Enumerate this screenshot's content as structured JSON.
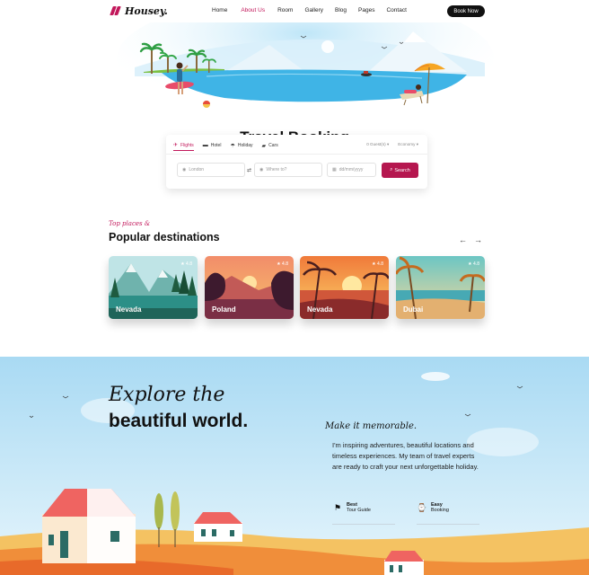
{
  "nav": {
    "logo_text": "Housey.",
    "items": [
      {
        "label": "Home",
        "active": false
      },
      {
        "label": "About Us",
        "active": true
      },
      {
        "label": "Room",
        "active": false
      },
      {
        "label": "Gallery",
        "active": false
      },
      {
        "label": "Blog",
        "active": false
      },
      {
        "label": "Pages",
        "active": false
      },
      {
        "label": "Contact",
        "active": false
      }
    ],
    "cta_label": "Book Now"
  },
  "hero": {
    "title": "Travel Booking"
  },
  "booking": {
    "tabs": [
      {
        "label": "Flights",
        "icon": "plane-icon",
        "active": true
      },
      {
        "label": "Hotel",
        "icon": "bed-icon",
        "active": false
      },
      {
        "label": "Holiday",
        "icon": "umbrella-icon",
        "active": false
      },
      {
        "label": "Cars",
        "icon": "car-icon",
        "active": false
      }
    ],
    "guests_label": "0 Guest(s)",
    "class_label": "Economy",
    "from_placeholder": "London",
    "to_placeholder": "Where to?",
    "date_placeholder": "dd/mm/yyyy",
    "search_label": "Search"
  },
  "destinations": {
    "subtitle": "Top places &",
    "title": "Popular destinations",
    "cards": [
      {
        "name": "Nevada",
        "rating": "4.8"
      },
      {
        "name": "Poland",
        "rating": "4.8"
      },
      {
        "name": "Nevada",
        "rating": "4.8"
      },
      {
        "name": "Dubai",
        "rating": "4.8"
      }
    ]
  },
  "explore": {
    "script_line": "Explore the",
    "bold_line": "beautiful world.",
    "memorable": "Make it memorable.",
    "paragraph": "I'm inspiring adventures, beautiful locations and timeless experiences. My team of travel experts are ready to craft your next unforgettable holiday.",
    "features": [
      {
        "line1": "Best",
        "line2": "Tour Guide",
        "icon": "guide-icon"
      },
      {
        "line1": "Easy",
        "line2": "Booking",
        "icon": "watch-icon"
      }
    ]
  },
  "colors": {
    "accent": "#c2185b",
    "search_button": "#b5174f",
    "sky": "#b9def3"
  }
}
